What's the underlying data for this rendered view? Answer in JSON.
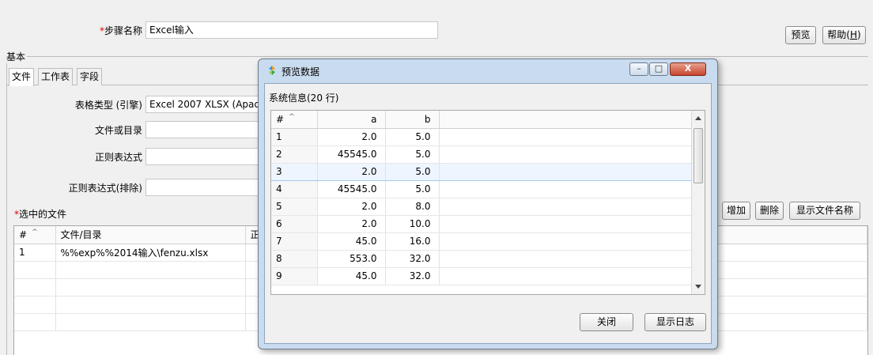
{
  "step": {
    "label_required": "*",
    "label": "步骤名称",
    "value": "Excel输入"
  },
  "top_buttons": {
    "preview": "预览",
    "help_text": "帮助(",
    "help_key": "H",
    "help_end": ")"
  },
  "group": {
    "title": "基本"
  },
  "tabs": [
    {
      "label": "文件"
    },
    {
      "label": "工作表"
    },
    {
      "label": "字段"
    }
  ],
  "form": {
    "table_type": {
      "label": "表格类型 (引擎)",
      "value": "Excel 2007 XLSX (Apac"
    },
    "file_or_dir": {
      "label": "文件或目录",
      "value": ""
    },
    "regex": {
      "label": "正则表达式",
      "value": ""
    },
    "regex_exclude": {
      "label": "正则表达式(排除)",
      "value": ""
    }
  },
  "selected_files": {
    "label_required": "*",
    "label": "选中的文件",
    "columns": [
      "#",
      "文件/目录",
      "正"
    ],
    "rows": [
      {
        "idx": "1",
        "path": "%%exp%%2014输入\\fenzu.xlsx"
      }
    ]
  },
  "side_buttons": {
    "add": "增加",
    "delete": "删除",
    "show_names": "显示文件名称"
  },
  "dialog": {
    "title": "预览数据",
    "info": "系统信息(20 行)",
    "columns": [
      "#",
      "a",
      "b"
    ],
    "rows": [
      {
        "idx": "1",
        "a": "2.0",
        "b": "5.0"
      },
      {
        "idx": "2",
        "a": "45545.0",
        "b": "5.0"
      },
      {
        "idx": "3",
        "a": "2.0",
        "b": "5.0"
      },
      {
        "idx": "4",
        "a": "45545.0",
        "b": "5.0"
      },
      {
        "idx": "5",
        "a": "2.0",
        "b": "8.0"
      },
      {
        "idx": "6",
        "a": "2.0",
        "b": "10.0"
      },
      {
        "idx": "7",
        "a": "45.0",
        "b": "16.0"
      },
      {
        "idx": "8",
        "a": "553.0",
        "b": "32.0"
      },
      {
        "idx": "9",
        "a": "45.0",
        "b": "32.0"
      }
    ],
    "buttons": {
      "close": "关闭",
      "show_log": "显示日志"
    },
    "window_buttons": {
      "minimize": "–",
      "maximize": "□",
      "close": "X"
    }
  },
  "colors": {
    "required": "#e00000",
    "dialog_frame": "#c9dbee",
    "close_button": "#c8452c"
  }
}
